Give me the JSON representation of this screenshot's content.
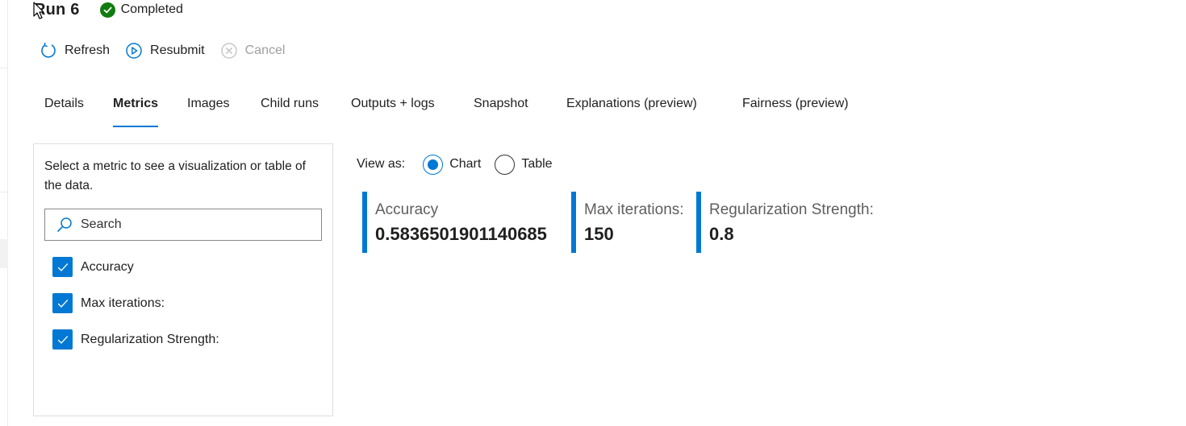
{
  "header": {
    "title": "Run 6",
    "status": "Completed",
    "status_color": "#107c10"
  },
  "toolbar": {
    "refresh_label": "Refresh",
    "resubmit_label": "Resubmit",
    "cancel_label": "Cancel"
  },
  "tabs": [
    {
      "label": "Details"
    },
    {
      "label": "Metrics",
      "active": true
    },
    {
      "label": "Images"
    },
    {
      "label": "Child runs"
    },
    {
      "label": "Outputs + logs"
    },
    {
      "label": "Snapshot"
    },
    {
      "label": "Explanations (preview)"
    },
    {
      "label": "Fairness (preview)"
    }
  ],
  "metrics_panel": {
    "hint": "Select a metric to see a visualization or table of the data.",
    "search_placeholder": "Search",
    "items": [
      {
        "label": "Accuracy",
        "checked": true
      },
      {
        "label": "Max iterations:",
        "checked": true
      },
      {
        "label": "Regularization Strength:",
        "checked": true
      }
    ]
  },
  "view_as": {
    "label": "View as:",
    "options": [
      {
        "label": "Chart",
        "selected": true
      },
      {
        "label": "Table",
        "selected": false
      }
    ]
  },
  "metric_tiles": [
    {
      "label": "Accuracy",
      "value": "0.5836501901140685"
    },
    {
      "label": "Max iterations:",
      "value": "150"
    },
    {
      "label": "Regularization Strength:",
      "value": "0.8"
    }
  ],
  "colors": {
    "accent": "#0078d4",
    "success": "#107c10"
  }
}
